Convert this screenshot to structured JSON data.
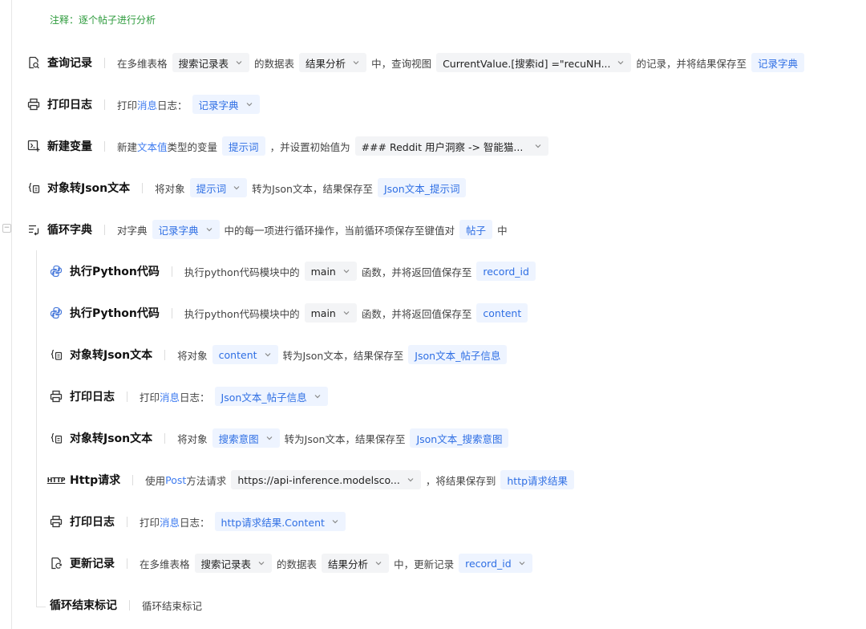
{
  "comment": "注释：逐个帖子进行分析",
  "steps": [
    {
      "title": "查询记录",
      "t1": "在多维表格",
      "c1": "搜索记录表",
      "t2": "的数据表",
      "c2": "结果分析",
      "t3": "中，查询视图",
      "c3": "CurrentValue.[搜索id] =\"recuNH...",
      "t4": "的记录，并将结果保存至",
      "c4": "记录字典"
    },
    {
      "title": "打印日志",
      "t1": "打印",
      "l1": "消息",
      "t2": "日志：",
      "c1": "记录字典"
    },
    {
      "title": "新建变量",
      "t1": "新建",
      "l1": "文本值",
      "t2": "类型的变量",
      "c1": "提示词",
      "t3": "，并设置初始值为",
      "c2": "### Reddit 用户洞察 -> 智能猫..."
    },
    {
      "title": "对象转Json文本",
      "t1": "将对象",
      "c1": "提示词",
      "t2": "转为Json文本，结果保存至",
      "c2": "Json文本_提示词"
    },
    {
      "title": "循环字典",
      "t1": "对字典",
      "c1": "记录字典",
      "t2": "中的每一项进行循环操作，当前循环项保存至键值对",
      "c2": "帖子",
      "t3": "中"
    },
    {
      "title": "执行Python代码",
      "t1": "执行python代码模块中的",
      "c1": "main",
      "t2": "函数，并将返回值保存至",
      "c2": "record_id"
    },
    {
      "title": "执行Python代码",
      "t1": "执行python代码模块中的",
      "c1": "main",
      "t2": "函数，并将返回值保存至",
      "c2": "content"
    },
    {
      "title": "对象转Json文本",
      "t1": "将对象",
      "c1": "content",
      "t2": "转为Json文本，结果保存至",
      "c2": "Json文本_帖子信息"
    },
    {
      "title": "打印日志",
      "t1": "打印",
      "l1": "消息",
      "t2": "日志：",
      "c1": "Json文本_帖子信息"
    },
    {
      "title": "对象转Json文本",
      "t1": "将对象",
      "c1": "搜索意图",
      "t2": "转为Json文本，结果保存至",
      "c2": "Json文本_搜索意图"
    },
    {
      "title": "Http请求",
      "icon_text": "HTTP",
      "t1": "使用",
      "l1": "Post",
      "t2": "方法请求",
      "c1": "https://api-inference.modelsco...",
      "t3": "，将结果保存到",
      "c2": "http请求结果"
    },
    {
      "title": "打印日志",
      "t1": "打印",
      "l1": "消息",
      "t2": "日志：",
      "c1": "http请求结果.Content"
    },
    {
      "title": "更新记录",
      "t1": "在多维表格",
      "c1": "搜索记录表",
      "t2": "的数据表",
      "c2": "结果分析",
      "t3": "中，更新记录",
      "c3": "record_id"
    },
    {
      "title": "循环结束标记",
      "t1": "循环结束标记"
    }
  ]
}
